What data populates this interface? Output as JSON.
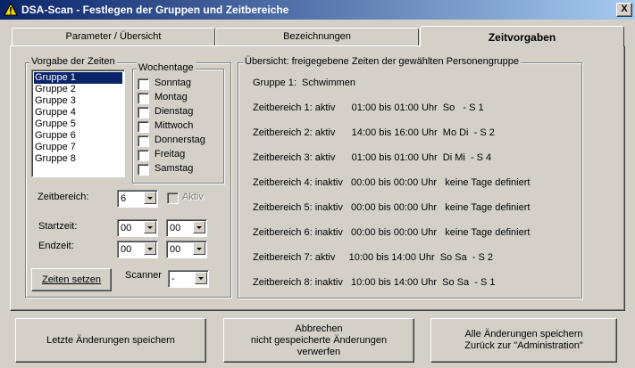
{
  "window": {
    "title": "DSA-Scan - Festlegen der Gruppen und Zeitbereiche",
    "close_label": "X"
  },
  "tabs": [
    {
      "label": "Parameter / Übersicht",
      "active": false
    },
    {
      "label": "Bezeichnungen",
      "active": false
    },
    {
      "label": "Zeitvorgaben",
      "active": true
    }
  ],
  "vorgabe": {
    "legend": "Vorgabe der Zeiten",
    "groups": [
      "Gruppe 1",
      "Gruppe 2",
      "Gruppe 3",
      "Gruppe 4",
      "Gruppe 5",
      "Gruppe 6",
      "Gruppe 7",
      "Gruppe 8"
    ],
    "selected_index": 0
  },
  "wochentage": {
    "legend": "Wochentage",
    "days": [
      {
        "label": "Sonntag",
        "checked": false
      },
      {
        "label": "Montag",
        "checked": false
      },
      {
        "label": "Dienstag",
        "checked": false
      },
      {
        "label": "Mittwoch",
        "checked": false
      },
      {
        "label": "Donnerstag",
        "checked": false
      },
      {
        "label": "Freitag",
        "checked": false
      },
      {
        "label": "Samstag",
        "checked": false
      }
    ]
  },
  "controls": {
    "zeitbereich_label": "Zeitbereich:",
    "zeitbereich_value": "6",
    "aktiv_label": "Aktiv",
    "aktiv_checked": false,
    "startzeit_label": "Startzeit:",
    "startzeit_hour": "00",
    "startzeit_minute": "00",
    "endzeit_label": "Endzeit:",
    "endzeit_hour": "00",
    "endzeit_minute": "00",
    "zeiten_setzen_label": "Zeiten setzen",
    "scanner_label": "Scanner",
    "scanner_value": "-"
  },
  "overview": {
    "legend": "Übersicht: freigegebene Zeiten der gewählten Personengruppe",
    "gruppe": "Gruppe 1:  Schwimmen",
    "rows": [
      "Zeitbereich 1: aktiv      01:00 bis 01:00 Uhr  So   - S 1",
      "Zeitbereich 2: aktiv      14:00 bis 16:00 Uhr  Mo Di  - S 2",
      "Zeitbereich 3: aktiv      01:00 bis 01:00 Uhr  Di Mi  - S 4",
      "Zeitbereich 4: inaktiv   00:00 bis 00:00 Uhr   keine Tage definiert",
      "Zeitbereich 5: inaktiv   00:00 bis 00:00 Uhr   keine Tage definiert",
      "Zeitbereich 6: inaktiv   00:00 bis 00:00 Uhr   keine Tage definiert",
      "Zeitbereich 7: aktiv     10:00 bis 14:00 Uhr  So Sa  - S 2",
      "Zeitbereich 8: inaktiv   10:00 bis 14:00 Uhr  So Sa  - S 1"
    ]
  },
  "buttons": {
    "save_last": "Letzte Änderungen speichern",
    "cancel_line1": "Abbrechen",
    "cancel_line2": "nicht gespeicherte Änderungen",
    "cancel_line3": "verwerfen",
    "save_all_line1": "Alle Änderungen speichern",
    "save_all_line2": "Zurück zur \"Administration\""
  },
  "colors": {
    "titlebar_start": "#0a246a",
    "titlebar_end": "#a6caf0",
    "face": "#d4d0c8",
    "selection": "#0a246a"
  }
}
